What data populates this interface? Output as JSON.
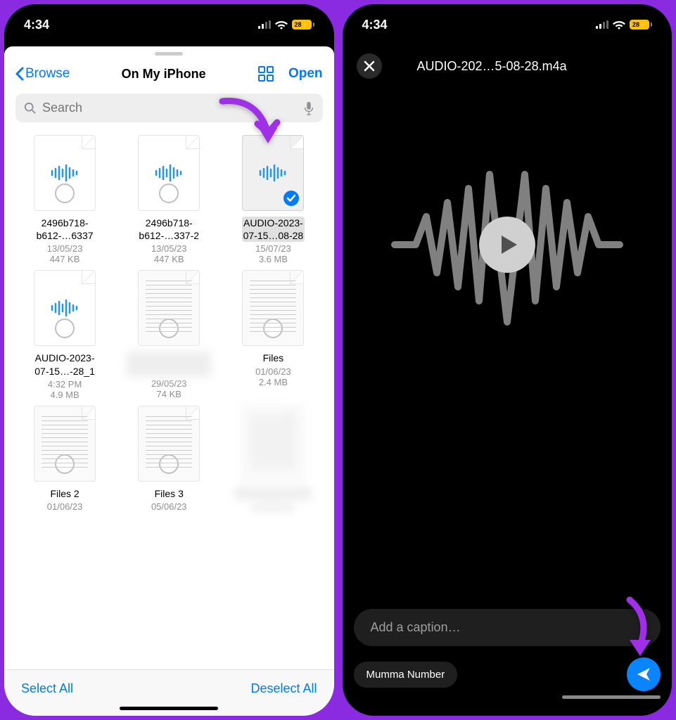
{
  "status": {
    "time": "4:34",
    "battery": "28"
  },
  "files": {
    "back": "Browse",
    "title": "On My iPhone",
    "open": "Open",
    "search_placeholder": "Search",
    "items": [
      {
        "name1": "2496b718-",
        "name2": "b612-…6337",
        "date": "13/05/23",
        "size": "447 KB"
      },
      {
        "name1": "2496b718-",
        "name2": "b612-…337-2",
        "date": "13/05/23",
        "size": "447 KB"
      },
      {
        "name1": "AUDIO-2023-",
        "name2": "07-15…08-28",
        "date": "15/07/23",
        "size": "3.6 MB"
      },
      {
        "name1": "AUDIO-2023-",
        "name2": "07-15…-28_1",
        "date": "4:32 PM",
        "size": "4.9 MB"
      },
      {
        "name1": "",
        "name2": "",
        "date": "29/05/23",
        "size": "74 KB"
      },
      {
        "name1": "Files",
        "name2": "",
        "date": "01/06/23",
        "size": "2.4 MB"
      },
      {
        "name1": "Files 2",
        "name2": "",
        "date": "01/06/23",
        "size": ""
      },
      {
        "name1": "Files 3",
        "name2": "",
        "date": "05/06/23",
        "size": ""
      },
      {
        "name1": "",
        "name2": "",
        "date": "",
        "size": ""
      }
    ],
    "select_all": "Select All",
    "deselect_all": "Deselect All"
  },
  "preview": {
    "filename": "AUDIO-202…5-08-28.m4a",
    "caption_placeholder": "Add a caption…",
    "recipient": "Mumma Number"
  }
}
